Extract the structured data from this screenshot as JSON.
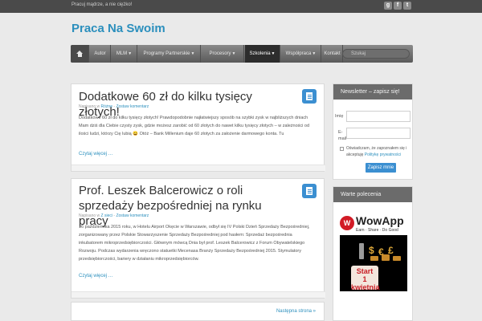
{
  "topbar": {
    "tagline": "Pracuj mądrze, a nie ciężko!",
    "social": [
      {
        "glyph": "g",
        "icon": "google-plus-icon"
      },
      {
        "glyph": "f",
        "icon": "facebook-icon"
      },
      {
        "glyph": "t",
        "icon": "twitter-icon"
      }
    ]
  },
  "site": {
    "title": "Praca Na Swoim"
  },
  "nav": {
    "items": [
      {
        "label": "Autor",
        "dropdown": false
      },
      {
        "label": "MLM",
        "dropdown": true
      },
      {
        "label": "Programy Partnerskie",
        "dropdown": true
      },
      {
        "label": "Procesory",
        "dropdown": true
      },
      {
        "label": "Szkolenia",
        "dropdown": true,
        "active": true
      },
      {
        "label": "Współpraca",
        "dropdown": true
      },
      {
        "label": "Kontakt",
        "dropdown": false
      }
    ],
    "search_placeholder": "Szukaj"
  },
  "posts": [
    {
      "title": "Dodatkowe 60 zł do kilku tysięcy złotych!",
      "meta_prefix": "Napisano w",
      "category": "Różne",
      "comment_link": "Zostaw komentarz",
      "body": "Dodatkowe 60 zł do kilku tysięcy złotych! Prawdopodobnie najłatwiejszy sposób na szybki zysk w najbliższych dniach Mam dziś dla Ciebie czysty zysk, gdzie możesz zarobić od 60 złotych do nawet kilku tysięcy złotych – w zależności od ilości ludzi, którzy Cię lubią 😀 Otóż – Bank Millenium daje 60 złotych za założenie darmowego konta. Tu",
      "more": "Czytaj więcej …"
    },
    {
      "title": "Prof. Leszek Balcerowicz o roli sprzedaży bezpośredniej na rynku pracy",
      "meta_prefix": "Napisano w",
      "category": "Z sieci",
      "comment_link": "Zostaw komentarz",
      "body": "16 października 2015 roku, w Hotelu Airport Okęcie w Warszawie, odbył się IV Polski Dzień Sprzedaży Bezpośredniej, zorganizowany przez Polskie Stowarzyszenie Sprzedaży Bezpośredniej pod hasłem: Sprzedaż bezpośrednia inkubatorem mikroprzedsiębiorczości. Głównym mówcą Dnia był prof. Leszek Balcerowicz z Forum Obywatelskiego Rozwoju. Podczas wydarzenia wręczono statuetki Mecenasa Branży Sprzedaży Bezpośredniej 2015. Stymulatory przedsiębiorczości, bariery w działaniu mikroprzedsiębiorców.",
      "more": "Czytaj więcej …"
    }
  ],
  "pager": {
    "next": "Następna strona »"
  },
  "newsletter": {
    "title": "Newsletter – zapisz się!",
    "name_label": "Imię",
    "email_label": "E-mail",
    "consent_text": "Oświadczam, że zapoznałem się i akceptuję",
    "consent_link": "Politykę prywatności",
    "button": "Zapisz mnie"
  },
  "recommend": {
    "title": "Warte polecenia",
    "ad_logo_letter": "W",
    "ad_brand": "WowApp",
    "ad_slogan": "Earn · Share · Do Good",
    "ad_start": "Start",
    "ad_date": "1 kwietnia"
  }
}
